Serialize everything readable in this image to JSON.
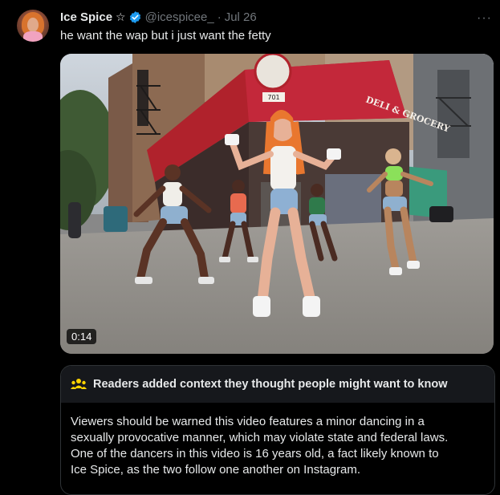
{
  "post": {
    "display_name": "Ice Spice",
    "star_glyph": "☆",
    "handle": "@icespicee_",
    "separator": "·",
    "time": "Jul 26",
    "more_glyph": "···",
    "text": "he want the wap but i just want the fetty",
    "verified_color": "#1d9bf0"
  },
  "media": {
    "duration": "0:14",
    "scene": {
      "awning_text": "DELI & GROCERY",
      "sign_number": "701"
    }
  },
  "note": {
    "title": "Readers added context they thought people might want to know",
    "body_lines": [
      "Viewers should be warned this video features a minor dancing in a",
      "sexually provocative manner, which may violate state and federal laws.",
      "One of the dancers in this video is 16 years old, a fact likely known to",
      "Ice Spice, as the two follow one another on Instagram."
    ],
    "icon_color": "#ffd400"
  }
}
